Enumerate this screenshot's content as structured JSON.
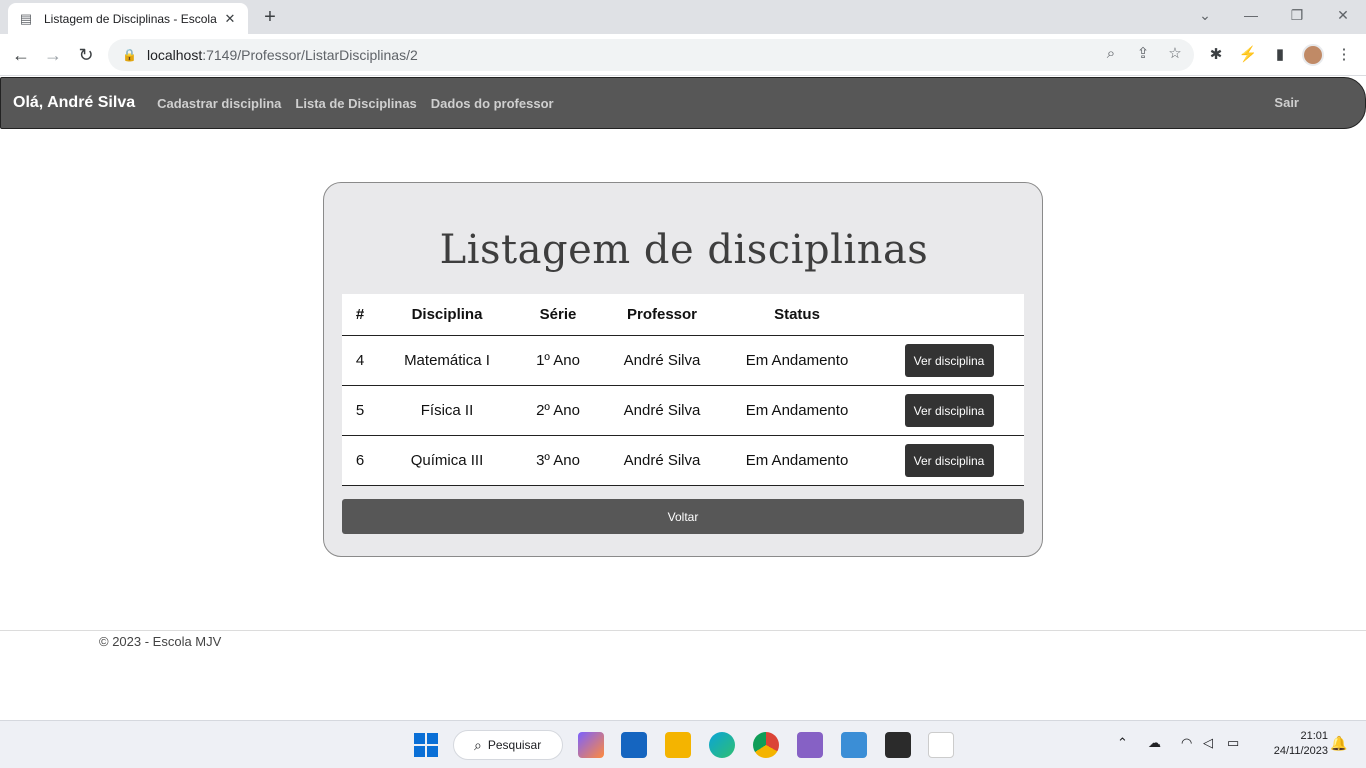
{
  "browser": {
    "tab_title": "Listagem de Disciplinas - Escola",
    "url_host": "localhost",
    "url_path": ":7149/Professor/ListarDisciplinas/2"
  },
  "nav": {
    "greeting": "Olá, André Silva",
    "links": [
      "Cadastrar disciplina",
      "Lista de Disciplinas",
      "Dados do professor"
    ],
    "logout": "Sair"
  },
  "page": {
    "title": "Listagem de disciplinas",
    "columns": [
      "#",
      "Disciplina",
      "Série",
      "Professor",
      "Status"
    ],
    "rows": [
      {
        "id": "4",
        "disciplina": "Matemática I",
        "serie": "1º Ano",
        "professor": "André Silva",
        "status": "Em Andamento",
        "action": "Ver disciplina"
      },
      {
        "id": "5",
        "disciplina": "Física II",
        "serie": "2º Ano",
        "professor": "André Silva",
        "status": "Em Andamento",
        "action": "Ver disciplina"
      },
      {
        "id": "6",
        "disciplina": "Química III",
        "serie": "3º Ano",
        "professor": "André Silva",
        "status": "Em Andamento",
        "action": "Ver disciplina"
      }
    ],
    "back_button": "Voltar"
  },
  "footer": {
    "copyright": "© 2023 - Escola MJV"
  },
  "taskbar": {
    "search_label": "Pesquisar",
    "time": "21:01",
    "date": "24/11/2023"
  },
  "colors": {
    "navbar": "#575757",
    "card": "#e9e9eb",
    "button": "#333333"
  }
}
